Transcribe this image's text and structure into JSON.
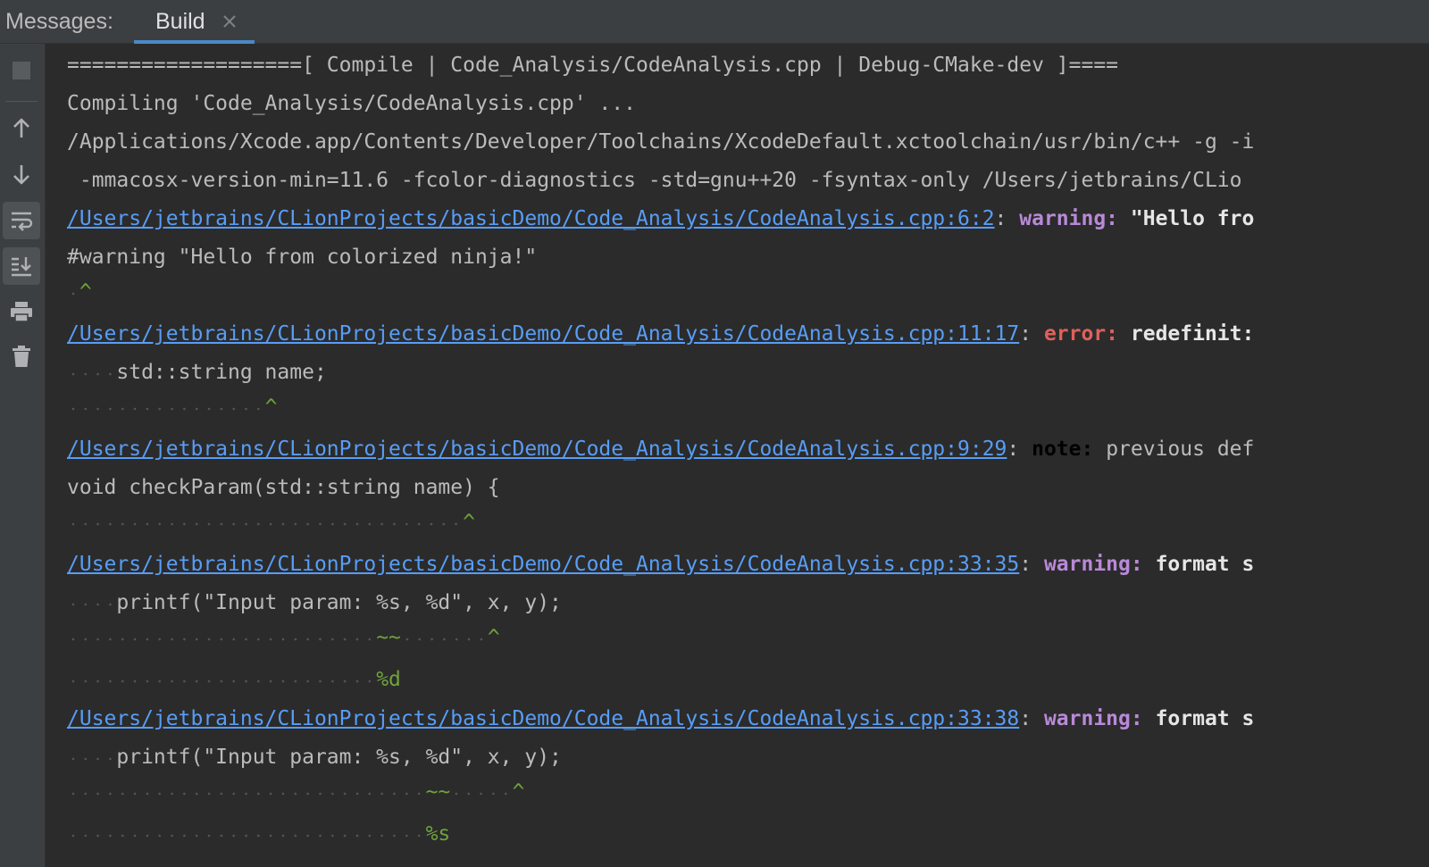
{
  "header": {
    "title": "Messages:",
    "tabs": [
      {
        "label": "Build",
        "active": true
      }
    ]
  },
  "toolbar": {
    "items": [
      {
        "icon": "stop-icon"
      },
      {
        "icon": "arrow-up-icon"
      },
      {
        "icon": "arrow-down-icon"
      },
      {
        "icon": "soft-wrap-icon"
      },
      {
        "icon": "scroll-to-end-icon"
      },
      {
        "icon": "print-icon"
      },
      {
        "icon": "trash-icon"
      }
    ]
  },
  "colors": {
    "link": "#589df6",
    "warning": "#b989d8",
    "error": "#e0605a",
    "caret": "#6fa23c",
    "text": "#bbbbbb",
    "background": "#2b2b2b",
    "tab_underline": "#4a88c7"
  },
  "console": {
    "header_line": "===================[ Compile | Code_Analysis/CodeAnalysis.cpp | Debug-CMake-dev ]====",
    "compiling_line": "Compiling 'Code_Analysis/CodeAnalysis.cpp' ...",
    "command_line_1": "/Applications/Xcode.app/Contents/Developer/Toolchains/XcodeDefault.xctoolchain/usr/bin/c++ -g -i",
    "command_line_2": " -mmacosx-version-min=11.6 -fcolor-diagnostics -std=gnu++20 -fsyntax-only /Users/jetbrains/CLio",
    "diagnostics": [
      {
        "location": "/Users/jetbrains/CLionProjects/basicDemo/Code_Analysis/CodeAnalysis.cpp:6:2",
        "sep": ": ",
        "kind": "warning:",
        "message": " \"Hello fro",
        "code": "#warning \"Hello from colorized ninja!\"",
        "caret": "^"
      },
      {
        "location": "/Users/jetbrains/CLionProjects/basicDemo/Code_Analysis/CodeAnalysis.cpp:11:17",
        "sep": ": ",
        "kind": "error:",
        "message": " redefinit:",
        "code": "std::string name;",
        "caret": "^"
      },
      {
        "location": "/Users/jetbrains/CLionProjects/basicDemo/Code_Analysis/CodeAnalysis.cpp:9:29",
        "sep": ": ",
        "kind": "note:",
        "message": " previous def",
        "code": "void checkParam(std::string name) {",
        "caret": "^"
      },
      {
        "location": "/Users/jetbrains/CLionProjects/basicDemo/Code_Analysis/CodeAnalysis.cpp:33:35",
        "sep": ": ",
        "kind": "warning:",
        "message": " format s",
        "code": "printf(\"Input param: %s, %d\", x, y);",
        "tilde": "~~",
        "caret": "^",
        "fixit": "%d"
      },
      {
        "location": "/Users/jetbrains/CLionProjects/basicDemo/Code_Analysis/CodeAnalysis.cpp:33:38",
        "sep": ": ",
        "kind": "warning:",
        "message": " format s",
        "code": "printf(\"Input param: %s, %d\", x, y);",
        "tilde": "~~",
        "caret": "^",
        "fixit": "%s"
      }
    ]
  }
}
